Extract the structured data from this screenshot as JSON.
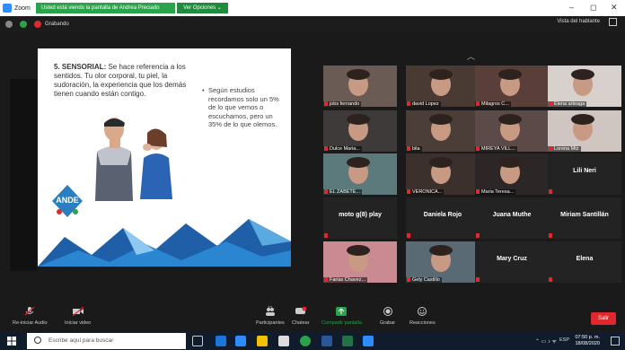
{
  "window": {
    "app_name": "Zoom",
    "share_banner": "Usted está viendo la pantalla de Andrea Preciado",
    "view_options": "Ver Opciones ⌄",
    "minimize": "–",
    "maximize": "◻",
    "close": "✕",
    "recording_label": "Grabando",
    "gallery_view": "Vista del hablante"
  },
  "slide": {
    "heading": "5. SENSORIAL:",
    "heading_text": "Se hace referencia a los sentidos. Tu olor corporal, tu piel, la sudoración, la experiencia que los demás tienen cuando están contigo.",
    "bullet": "Según estudios recordamos solo un 5% de lo que vemos o escuchamos, pero un 35% de lo que olemos.",
    "logo_text": "ANDE"
  },
  "participants": [
    {
      "name": "jobs fernando",
      "kind": "video",
      "bg": "#6b5b55"
    },
    {
      "name": "david Lopez",
      "kind": "video",
      "bg": "#4a3a34"
    },
    {
      "name": "Milagros C...",
      "kind": "video",
      "bg": "#5a3e3a"
    },
    {
      "name": "Elena arteaga",
      "kind": "video",
      "bg": "#d8d0cc"
    },
    {
      "name": "Dulce Maria...",
      "kind": "video",
      "bg": "#3f3a3a"
    },
    {
      "name": "bila",
      "kind": "video",
      "bg": "#4b3d38"
    },
    {
      "name": "MIREYA VILL...",
      "kind": "video",
      "bg": "#5c4a48"
    },
    {
      "name": "Lorena Mtz",
      "kind": "video",
      "bg": "#cfc6c2"
    },
    {
      "name": "EL ZABETE...",
      "kind": "video",
      "bg": "#5c7a7c"
    },
    {
      "name": "VERONICA...",
      "kind": "video",
      "bg": "#3b302c"
    },
    {
      "name": "Maria Teresa...",
      "kind": "video",
      "bg": "#2c2626"
    },
    {
      "name": "Lili Neri",
      "kind": "name"
    },
    {
      "name": "moto g(8) play",
      "kind": "name"
    },
    {
      "name": "Daniela Rojo",
      "kind": "name"
    },
    {
      "name": "Juana Muthe",
      "kind": "name"
    },
    {
      "name": "Miriam Santillán",
      "kind": "name"
    },
    {
      "name": "Farias Chavez...",
      "kind": "video",
      "bg": "#c98a92"
    },
    {
      "name": "Gely Castillo",
      "kind": "video",
      "bg": "#5a6a74"
    },
    {
      "name": "Mary Cruz",
      "kind": "name"
    },
    {
      "name": "Elena",
      "kind": "name"
    }
  ],
  "toolbar": {
    "audio": "Re-iniciar Audio",
    "video": "Iniciar video",
    "participants": "Participantes",
    "participants_count": "31",
    "chat": "Chatear",
    "share": "Compartir pantalla",
    "record": "Grabar",
    "reactions": "Reacciones",
    "leave": "Salir"
  },
  "taskbar": {
    "search_placeholder": "Escribe aquí para buscar",
    "time": "07:50 p. m.",
    "date": "18/08/2020",
    "lang": "ESP"
  },
  "colors": {
    "zoom_blue": "#2d8cff",
    "share_green": "#2aa34a",
    "leave_red": "#e0292f",
    "taskbar": "#101c2c"
  }
}
